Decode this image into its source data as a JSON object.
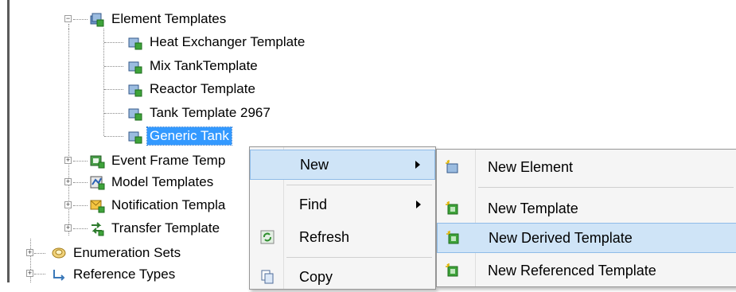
{
  "tree": {
    "element_templates": {
      "label": "Element Templates",
      "icon": "element-templates-icon"
    },
    "children": [
      {
        "label": "Heat Exchanger Template",
        "icon": "template-icon"
      },
      {
        "label": "Mix TankTemplate",
        "icon": "template-icon"
      },
      {
        "label": "Reactor Template",
        "icon": "template-icon"
      },
      {
        "label": "Tank Template 2967",
        "icon": "template-icon"
      },
      {
        "label": "Generic Tank",
        "icon": "template-icon",
        "selected": true
      }
    ],
    "other_nodes": [
      {
        "label": "Event Frame Temp",
        "icon": "event-frame-icon"
      },
      {
        "label": "Model Templates",
        "icon": "model-templates-icon"
      },
      {
        "label": "Notification Templa",
        "icon": "notification-icon"
      },
      {
        "label": "Transfer Template",
        "icon": "transfer-icon"
      }
    ],
    "root_nodes": [
      {
        "label": "Enumeration Sets",
        "icon": "enumeration-sets-icon"
      },
      {
        "label": "Reference Types",
        "icon": "reference-types-icon"
      }
    ]
  },
  "context_menu": {
    "items": [
      {
        "label": "New",
        "submenu": true,
        "highlighted": true
      },
      {
        "label": "Find",
        "submenu": true
      },
      {
        "label": "Refresh",
        "icon": "refresh-icon"
      },
      {
        "label": "Copy",
        "icon": "copy-icon"
      }
    ]
  },
  "submenu": {
    "items": [
      {
        "label": "New Element",
        "icon": "new-element-icon"
      },
      {
        "label": "New Template",
        "icon": "new-template-icon"
      },
      {
        "label": "New Derived Template",
        "icon": "new-derived-template-icon",
        "highlighted": true
      },
      {
        "label": "New Referenced Template",
        "icon": "new-referenced-template-icon"
      }
    ]
  },
  "colors": {
    "selection": "#3399ff",
    "menu_highlight": "#cfe4f7",
    "menu_bg": "#f5f5f5"
  }
}
